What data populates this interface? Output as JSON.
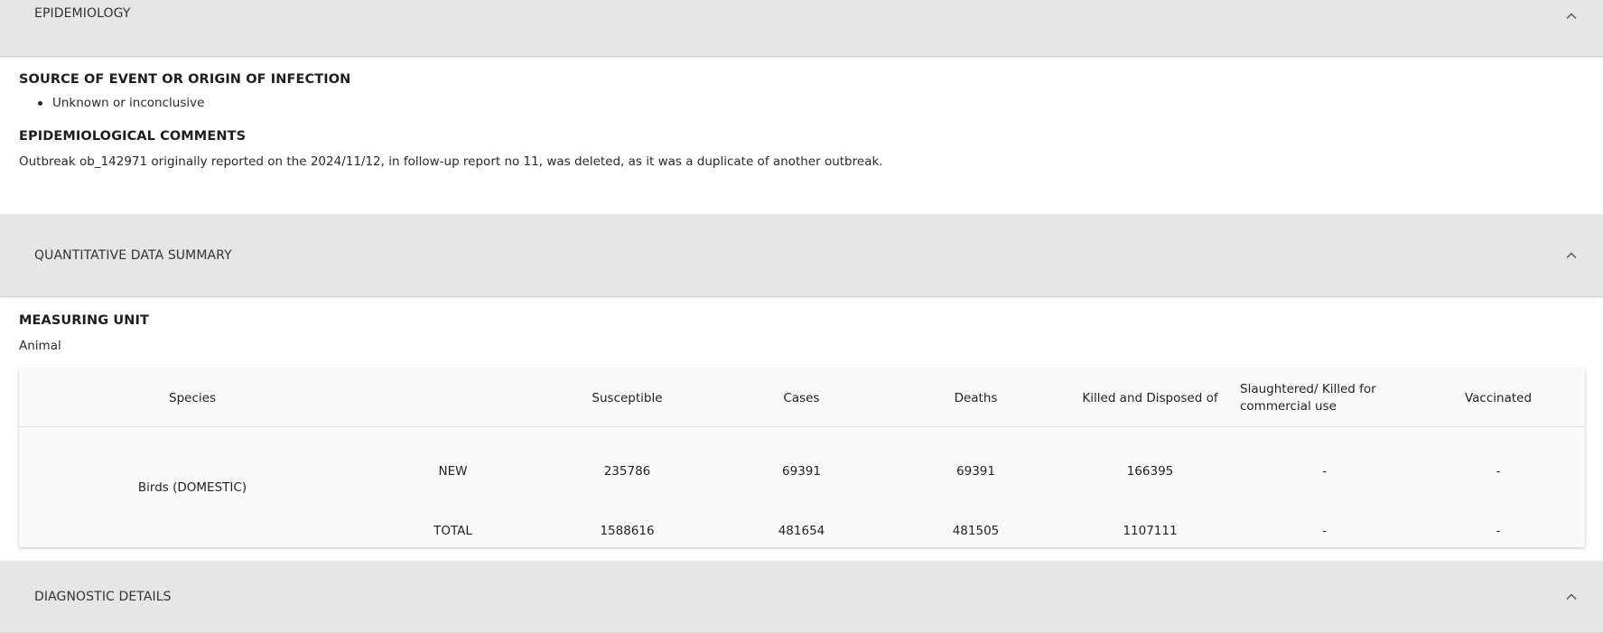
{
  "sections": {
    "epidemiology": {
      "title": "EPIDEMIOLOGY"
    },
    "quantitative": {
      "title": "QUANTITATIVE DATA SUMMARY"
    },
    "diagnostic": {
      "title": "DIAGNOSTIC DETAILS"
    }
  },
  "epidemiology": {
    "source_heading": "SOURCE OF EVENT OR ORIGIN OF INFECTION",
    "sources": [
      "Unknown or inconclusive"
    ],
    "comments_heading": "EPIDEMIOLOGICAL COMMENTS",
    "comments": "Outbreak ob_142971 originally reported on the 2024/11/12, in follow-up report no 11, was deleted, as it was a duplicate of another outbreak."
  },
  "quantitative": {
    "measuring_unit_heading": "MEASURING UNIT",
    "measuring_unit": "Animal",
    "table": {
      "headers": {
        "species": "Species",
        "susceptible": "Susceptible",
        "cases": "Cases",
        "deaths": "Deaths",
        "killed": "Killed and Disposed of",
        "slaughtered": "Slaughtered/ Killed for commercial use",
        "vaccinated": "Vaccinated"
      },
      "species": "Birds (DOMESTIC)",
      "rows": [
        {
          "type": "NEW",
          "susceptible": "235786",
          "cases": "69391",
          "deaths": "69391",
          "killed": "166395",
          "slaughtered": "-",
          "vaccinated": "-"
        },
        {
          "type": "TOTAL",
          "susceptible": "1588616",
          "cases": "481654",
          "deaths": "481505",
          "killed": "1107111",
          "slaughtered": "-",
          "vaccinated": "-"
        }
      ]
    }
  },
  "icons": {
    "collapse": "chevron-up-icon"
  }
}
